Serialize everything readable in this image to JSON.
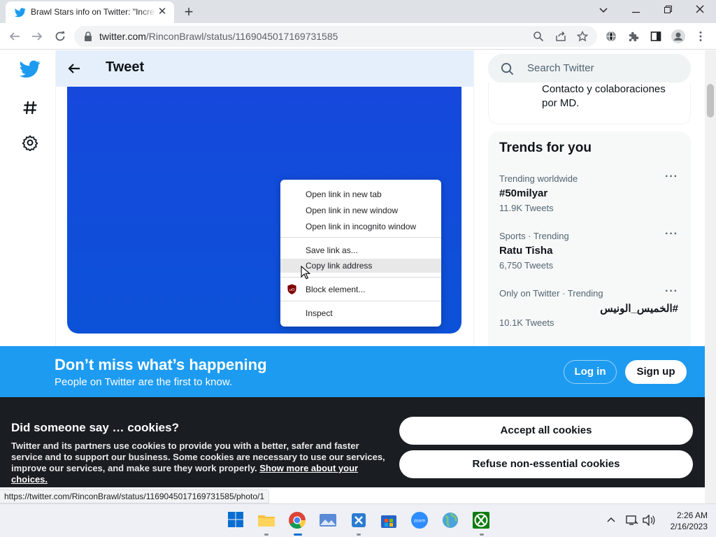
{
  "browser": {
    "tab_title": "Brawl Stars info on Twitter: \"Incre",
    "url_host": "twitter.com",
    "url_path": "/RinconBrawl/status/1169045017169731585",
    "status_url": "https://twitter.com/RinconBrawl/status/1169045017169731585/photo/1"
  },
  "header": {
    "title": "Tweet"
  },
  "search": {
    "placeholder": "Search Twitter"
  },
  "profile": {
    "bio": "Contacto y colaboraciones por MD."
  },
  "trends": {
    "heading": "Trends for you",
    "items": [
      {
        "meta": "Trending worldwide",
        "name": "#50milyar",
        "count": "11.9K Tweets"
      },
      {
        "meta": "Sports · Trending",
        "name": "Ratu Tisha",
        "count": "6,750 Tweets"
      },
      {
        "meta": "Only on Twitter · Trending",
        "name": "#الخميس_الونيس",
        "count": "10.1K Tweets"
      }
    ]
  },
  "context_menu": {
    "items": [
      "Open link in new tab",
      "Open link in new window",
      "Open link in incognito window",
      "Save link as...",
      "Copy link address",
      "Block element...",
      "Inspect"
    ]
  },
  "banner": {
    "heading": "Don’t miss what’s happening",
    "subtext": "People on Twitter are the first to know.",
    "login": "Log in",
    "signup": "Sign up"
  },
  "cookies": {
    "heading": "Did someone say … cookies?",
    "body": "Twitter and its partners use cookies to provide you with a better, safer and faster service and to support our business. Some cookies are necessary to use our services, improve our services, and make sure they work properly.",
    "link": "Show more about your choices.",
    "accept": "Accept all cookies",
    "refuse": "Refuse non-essential cookies"
  },
  "clock": {
    "time": "2:26 AM",
    "date": "2/16/2023"
  },
  "colors": {
    "twitter_blue": "#1d9bf0",
    "cookie_bg": "#1a1d21"
  }
}
